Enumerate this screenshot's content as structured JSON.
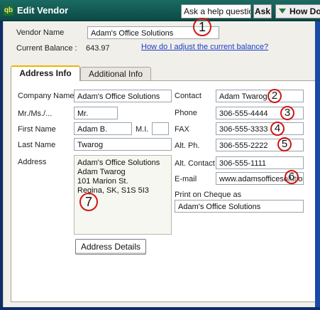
{
  "window": {
    "title": "Edit Vendor",
    "app_icon": "qb"
  },
  "toolbar": {
    "help_question": "Ask a help question",
    "ask_label": "Ask",
    "howdo_label": "How Do"
  },
  "vendor": {
    "name_label": "Vendor Name",
    "name_value": "Adam's Office Solutions",
    "balance_label": "Current Balance :",
    "balance_value": "643.97",
    "adjust_link": "How do I adjust the current balance?"
  },
  "tabs": {
    "address_info": "Address Info",
    "additional_info": "Additional Info"
  },
  "form": {
    "company_name_label": "Company Name",
    "company_name_value": "Adam's Office Solutions",
    "salutation_label": "Mr./Ms./...",
    "salutation_value": "Mr.",
    "first_name_label": "First Name",
    "first_name_value": "Adam B.",
    "mi_label": "M.I.",
    "mi_value": "",
    "last_name_label": "Last Name",
    "last_name_value": "Twarog",
    "address_label": "Address",
    "address_lines": [
      "Adam's Office Solutions",
      "Adam Twarog",
      "101 Marion St.",
      "Regina, SK, S1S 5I3"
    ],
    "address_details_button": "Address Details",
    "contact_label": "Contact",
    "contact_value": "Adam Twarog",
    "phone_label": "Phone",
    "phone_value": "306-555-4444",
    "fax_label": "FAX",
    "fax_value": "306-555-3333",
    "alt_phone_label": "Alt. Ph.",
    "alt_phone_value": "306-555-2222",
    "alt_contact_label": "Alt. Contact",
    "alt_contact_value": "306-555-1111",
    "email_label": "E-mail",
    "email_value": "www.adamsofficesolutions.com",
    "print_cheque_label": "Print on Cheque as",
    "print_cheque_value": "Adam's Office Solutions"
  },
  "callouts": [
    "1",
    "2",
    "3",
    "4",
    "5",
    "6",
    "7"
  ],
  "colors": {
    "titlebar": "#0c4a45",
    "dialog_bg": "#f0efe9",
    "link": "#1c3fc7",
    "callout_ring": "#d01616",
    "window_border": "#0e2b6a"
  }
}
